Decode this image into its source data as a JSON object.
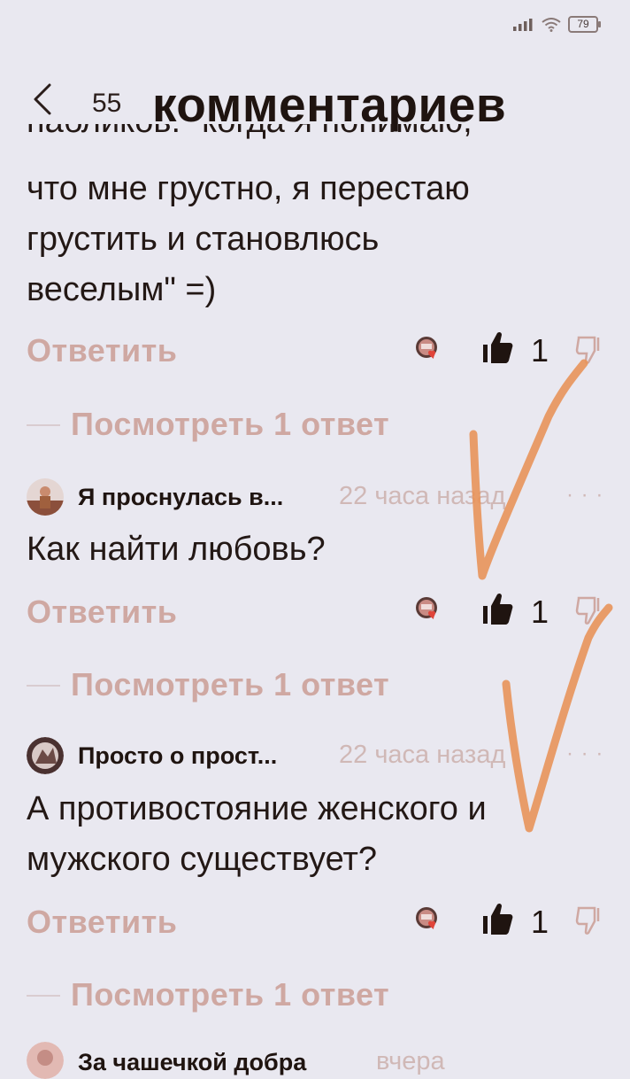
{
  "status_bar": {
    "battery": "79"
  },
  "header": {
    "count": "55",
    "title": "комментариев"
  },
  "comments": [
    {
      "text_clipped": "пабликов: \"когда я понимаю,",
      "text": "что мне грустно, я перестаю\nгрустить и становлюсь\nвеселым\" =)",
      "reply_label": "Ответить",
      "likes": "1",
      "view_replies": "Посмотреть 1 ответ"
    },
    {
      "author": "Я проснулась в...",
      "time": "22 часа назад",
      "text": "Как найти любовь?",
      "reply_label": "Ответить",
      "likes": "1",
      "view_replies": "Посмотреть 1 ответ"
    },
    {
      "author": "Просто о прост...",
      "time": "22 часа назад",
      "text": "А противостояние женского и\nмужского существует?",
      "reply_label": "Ответить",
      "likes": "1",
      "view_replies": "Посмотреть 1 ответ"
    },
    {
      "author": "За чашечкой добра",
      "time": "вчера"
    }
  ],
  "colors": {
    "background": "#e9e8f0",
    "muted_pink": "#cfa8a2",
    "text": "#231815",
    "annotation": "#e8945a"
  }
}
